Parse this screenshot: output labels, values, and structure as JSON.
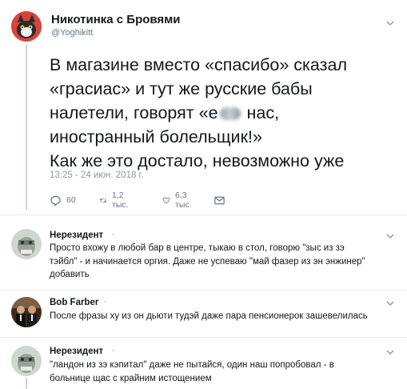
{
  "tweet": {
    "author_name": "Никотинка с Бровями",
    "author_handle": "@Yoghikitt",
    "lines": [
      "В магазине вместо «спасибо» сказал",
      "«грасиас» и тут же русские бабы",
      "налетели, говорят «е",
      " нас,",
      "иностранный болельщик!»",
      "Как же это достало, невозможно уже"
    ],
    "timestamp": "13:25 - 24 июн. 2018 г.",
    "reply_count": "60",
    "retweet_count": "1,2 тыс.",
    "like_count": "6,3 тыс."
  },
  "replies": [
    {
      "name": "Нерезидент",
      "dot": "·",
      "lines": [
        "Просто вхожу в любой бар в центре, тыкаю в стол, говорю \"зыс из зэ",
        "тэйбл\" - и начинается оргия. Даже не успеваю \"май фазер из эн энжинер\"",
        "добавить"
      ]
    },
    {
      "name": "Bob Farber",
      "dot": "·",
      "lines": [
        "После фразы ху из он дьюти тудэй даже пара пенсионерок зашевелилась"
      ]
    },
    {
      "name": "Нерезидент",
      "dot": "·",
      "lines": [
        "\"ландон из зэ кэпитал\" даже не пытайся, один наш попробовал - в",
        "больнице щас с крайним истощением"
      ]
    }
  ],
  "icons": {
    "reply": "reply-icon",
    "retweet": "retweet-icon",
    "like": "heart-icon",
    "message": "envelope-icon",
    "menu": "chevron-down-icon"
  },
  "colors": {
    "text": "#14171a",
    "secondary": "#657786",
    "divider": "#e6ecf0"
  }
}
